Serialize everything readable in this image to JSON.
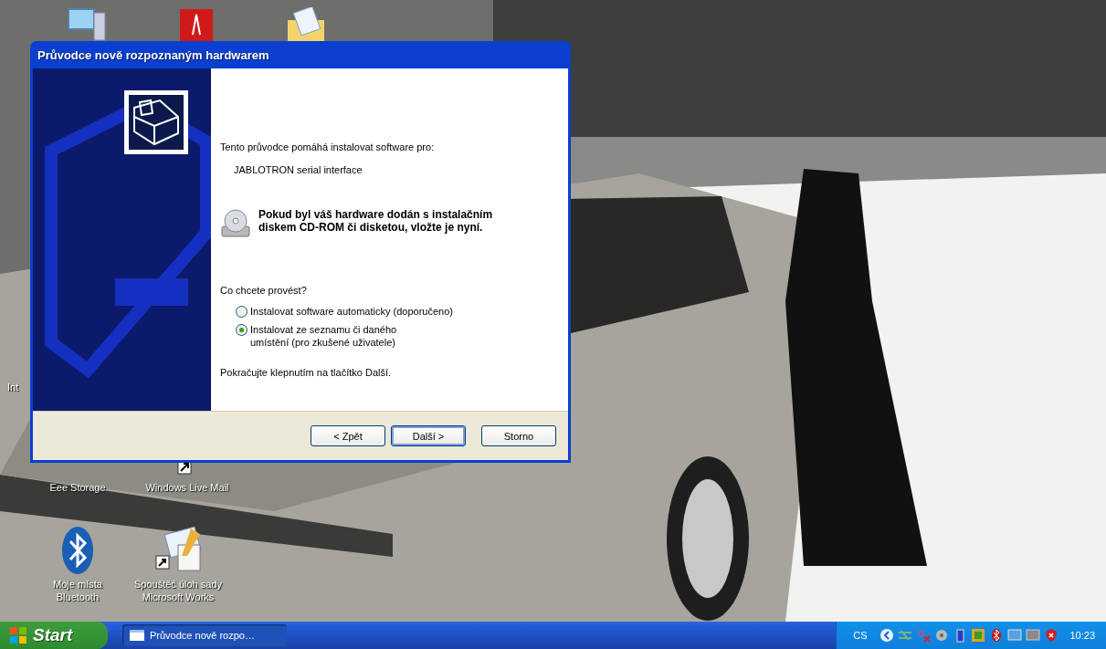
{
  "desktop": {
    "icons": [
      {
        "kind": "computer"
      },
      {
        "kind": "pdf"
      },
      {
        "kind": "folder"
      },
      {
        "kind": "none",
        "label": "Int"
      },
      {
        "kind": "drive",
        "label": "Eee Storage"
      },
      {
        "kind": "mail",
        "label": "Windows Live Mail"
      },
      {
        "kind": "bluetooth",
        "label": "Moje místa\nBluetooth"
      },
      {
        "kind": "works",
        "label": "Spouštěč úloh sady\nMicrosoft Works"
      }
    ]
  },
  "dialog": {
    "title": "Průvodce nově rozpoznaným hardwarem",
    "intro": "Tento průvodce pomáhá instalovat software pro:",
    "device": "JABLOTRON serial interface",
    "notice": "Pokud byl váš hardware dodán s instalačním diskem CD-ROM či disketou, vložte je nyní.",
    "question": "Co chcete provést?",
    "options": [
      {
        "label": "Instalovat software automaticky (doporučeno)",
        "selected": false
      },
      {
        "label": "Instalovat ze seznamu či daného\numístění (pro zkušené uživatele)",
        "selected": true
      }
    ],
    "hint": "Pokračujte klepnutím na tlačítko Další.",
    "buttons": [
      {
        "label": "< Zpět",
        "default": false
      },
      {
        "label": "Další >",
        "default": true
      },
      {
        "label": "Storno",
        "default": false
      }
    ]
  },
  "taskbar": {
    "start": "Start",
    "tasks": [
      {
        "label": "Průvodce nově rozpo…",
        "selected": true
      }
    ],
    "language": "CS",
    "clock": "10:23"
  }
}
